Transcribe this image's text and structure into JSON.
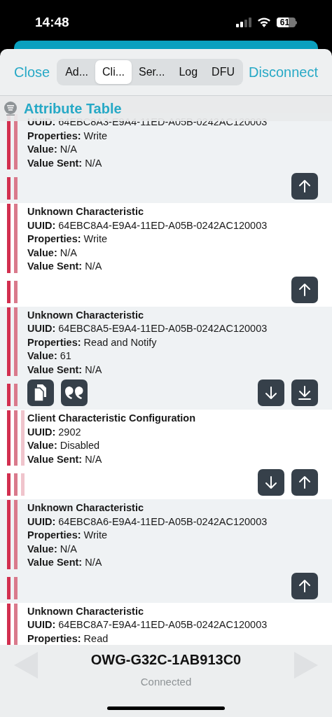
{
  "status_bar": {
    "time": "14:48",
    "battery": "61"
  },
  "header": {
    "close": "Close",
    "disconnect": "Disconnect",
    "tabs": [
      {
        "label": "Ad...",
        "selected": false
      },
      {
        "label": "Cli...",
        "selected": true
      },
      {
        "label": "Ser...",
        "selected": false
      },
      {
        "label": "Log",
        "selected": false
      },
      {
        "label": "DFU",
        "selected": false
      }
    ]
  },
  "section": {
    "title": "Attribute Table"
  },
  "attributes": [
    {
      "lines": [
        "**UUID:** 64EBC8A3-E9A4-11ED-A05B-0242AC120003",
        "**Properties:** Write",
        "**Value:** N/A",
        "**Value Sent:** N/A"
      ],
      "buttons": [
        {
          "kind": "up"
        }
      ]
    },
    {
      "title": "Unknown Characteristic",
      "lines": [
        "**UUID:** 64EBC8A4-E9A4-11ED-A05B-0242AC120003",
        "**Properties:** Write",
        "**Value:** N/A",
        "**Value Sent:** N/A"
      ],
      "buttons": [
        {
          "kind": "up"
        }
      ]
    },
    {
      "title": "Unknown Characteristic",
      "lines": [
        "**UUID:** 64EBC8A5-E9A4-11ED-A05B-0242AC120003",
        "**Properties:** Read and Notify",
        "**Value:** 61",
        "**Value Sent:** N/A"
      ],
      "buttons": [
        {
          "kind": "copy"
        },
        {
          "kind": "quote"
        },
        {
          "kind": "down"
        },
        {
          "kind": "download"
        }
      ],
      "children": [
        {
          "title": "Client Characteristic Configuration",
          "lines": [
            "**UUID:** 2902",
            "**Value:** Disabled",
            "**Value Sent:** N/A"
          ],
          "buttons": [
            {
              "kind": "down"
            },
            {
              "kind": "up"
            }
          ]
        }
      ]
    },
    {
      "title": "Unknown Characteristic",
      "lines": [
        "**UUID:** 64EBC8A6-E9A4-11ED-A05B-0242AC120003",
        "**Properties:** Write",
        "**Value:** N/A",
        "**Value Sent:** N/A"
      ],
      "buttons": [
        {
          "kind": "up"
        }
      ]
    },
    {
      "title": "Unknown Characteristic",
      "lines": [
        "**UUID:** 64EBC8A7-E9A4-11ED-A05B-0242AC120003",
        "**Properties:** Read"
      ]
    }
  ],
  "footer": {
    "device": "OWG-G32C-1AB913C0",
    "status": "Connected",
    "previous_button": {
      "disabled": true
    },
    "next_button": {
      "disabled": true
    }
  }
}
